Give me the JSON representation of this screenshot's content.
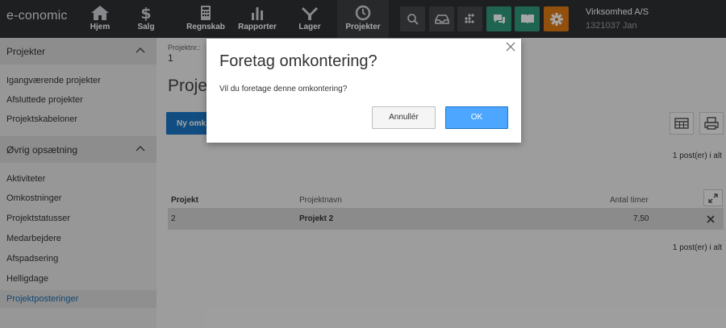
{
  "app": {
    "logo": "e-conomic",
    "company": "Virksomhed A/S",
    "user": "1321037 Jan"
  },
  "nav": [
    {
      "label": "Hjem",
      "icon": "home-icon"
    },
    {
      "label": "Salg",
      "icon": "dollar-icon"
    },
    {
      "label": "Regnskab",
      "icon": "calculator-icon"
    },
    {
      "label": "Rapporter",
      "icon": "bar-chart-icon"
    },
    {
      "label": "Lager",
      "icon": "lager-icon"
    },
    {
      "label": "Projekter",
      "icon": "clock-icon"
    }
  ],
  "tools": [
    {
      "icon": "search-icon"
    },
    {
      "icon": "inbox-icon"
    },
    {
      "icon": "apps-icon"
    },
    {
      "icon": "chat-icon"
    },
    {
      "icon": "book-icon"
    },
    {
      "icon": "gear-icon"
    }
  ],
  "sidebar": {
    "section1": {
      "title": "Projekter",
      "items": [
        "Igangværende projekter",
        "Afsluttede projekter",
        "Projektskabeloner"
      ]
    },
    "section2": {
      "title": "Øvrig opsætning",
      "items": [
        "Aktiviteter",
        "Omkostninger",
        "Projektstatusser",
        "Medarbejdere",
        "Afspadsering",
        "Helligdage",
        "Projektposteringer"
      ]
    }
  },
  "main": {
    "projnr_label": "Projektnr.:",
    "projnr_value": "1",
    "title": "Proje",
    "new_button": "Ny omk",
    "count_top": "1 post(er) i alt",
    "count_bottom": "1 post(er) i alt",
    "table": {
      "headers": [
        "Projekt",
        "Projektnavn",
        "Antal timer"
      ],
      "rows": [
        {
          "projekt": "2",
          "navn": "Projekt 2",
          "timer": "7,50"
        }
      ]
    }
  },
  "modal": {
    "title": "Foretag omkontering?",
    "text": "Vil du foretage denne omkontering?",
    "cancel": "Annullér",
    "ok": "OK"
  },
  "colors": {
    "topbar": "#2e3033",
    "primary": "#1b77c6",
    "ok": "#4da6ff",
    "green": "#2e9a7c",
    "orange": "#e07b14"
  }
}
